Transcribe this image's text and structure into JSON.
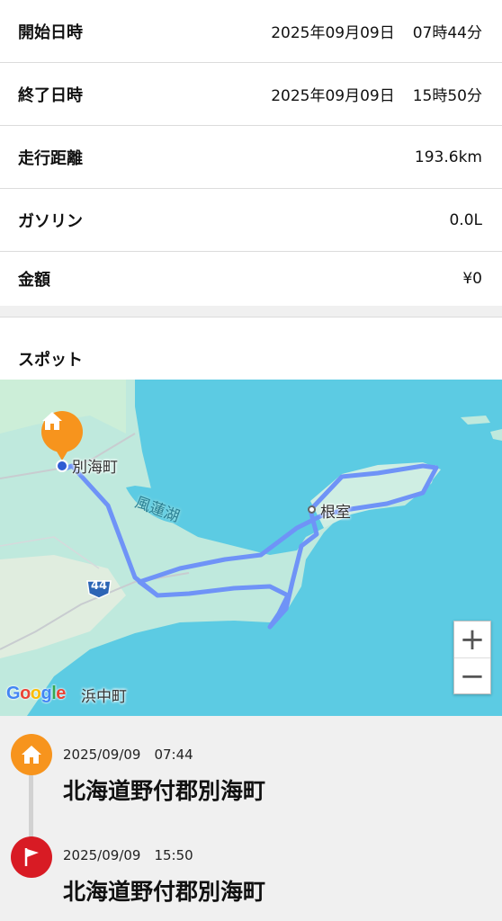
{
  "info_rows": [
    {
      "label": "開始日時",
      "date": "2025年09月09日",
      "time": "07時44分"
    },
    {
      "label": "終了日時",
      "date": "2025年09月09日",
      "time": "15時50分"
    },
    {
      "label": "走行距離",
      "value": "193.6km"
    },
    {
      "label": "ガソリン",
      "value": "0.0L"
    },
    {
      "label": "金額",
      "value": "¥0"
    }
  ],
  "spot_section": {
    "title": "スポット"
  },
  "map": {
    "labels": {
      "start_town": "別海町",
      "lake": "風蓮湖",
      "city": "根室",
      "route_number": "44",
      "bottom_town": "浜中町"
    },
    "google_logo": [
      "G",
      "o",
      "o",
      "g",
      "l",
      "e"
    ],
    "zoom_in": "+",
    "zoom_out": "−",
    "colors": {
      "route": "#6f93f7",
      "water": "#5ccbe3",
      "land": "#bfe9dd"
    }
  },
  "timeline": [
    {
      "icon": "home-icon",
      "time": "2025/09/09　07:44",
      "place": "北海道野付郡別海町",
      "color": "#f7941d"
    },
    {
      "icon": "flag-icon",
      "time": "2025/09/09　15:50",
      "place": "北海道野付郡別海町",
      "color": "#d81b24"
    }
  ]
}
